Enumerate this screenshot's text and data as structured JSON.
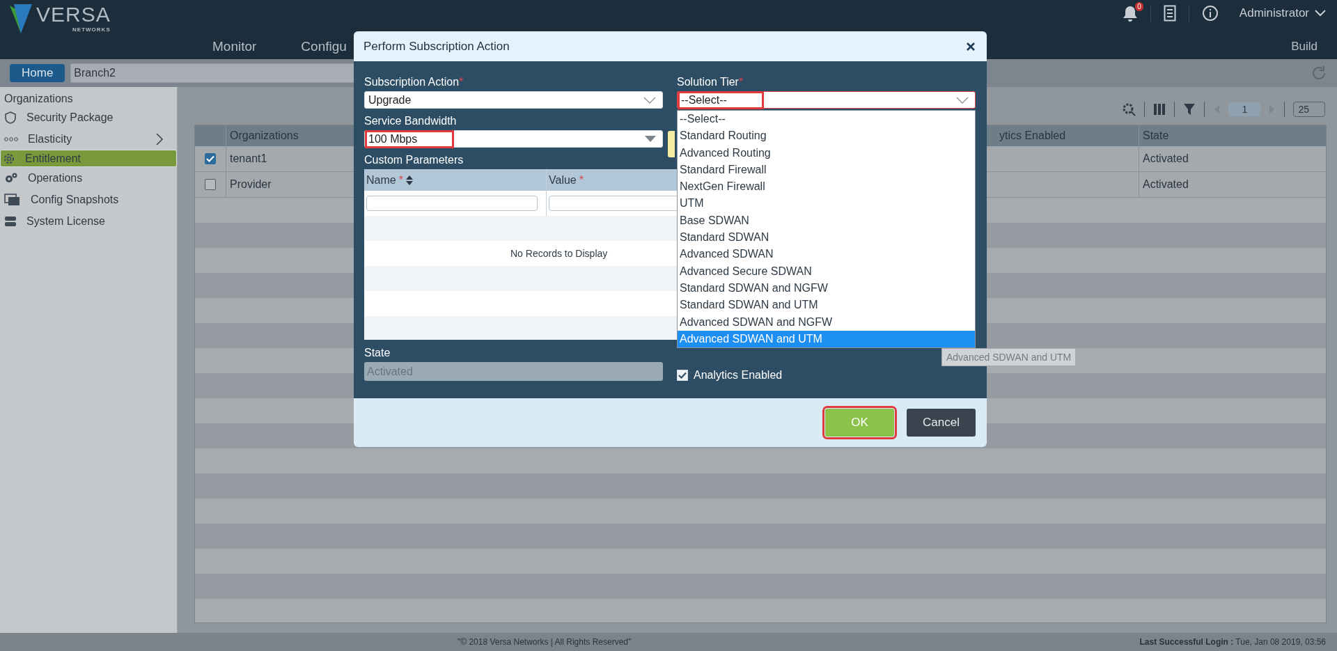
{
  "header": {
    "logo_text": "VERSA",
    "logo_sub": "NETWORKS",
    "notification_count": "0",
    "user": "Administrator"
  },
  "nav": [
    {
      "label": "Monitor",
      "selected": false
    },
    {
      "label": "Configu",
      "selected": false
    }
  ],
  "nav_right": {
    "label": "Build",
    "selected": false
  },
  "breadcrumb": {
    "home": "Home",
    "branch": "Branch2"
  },
  "sidebar": {
    "heading": "Organizations",
    "items": [
      {
        "label": "Security Package",
        "kind": "shield",
        "selected": false,
        "expandable": false
      },
      {
        "label": "Elasticity",
        "kind": "chain",
        "selected": false,
        "expandable": true
      },
      {
        "label": "Entitlement",
        "kind": "gear",
        "selected": true,
        "expandable": false
      },
      {
        "label": "Operations",
        "kind": "gears",
        "selected": false,
        "expandable": false
      },
      {
        "label": "Config Snapshots",
        "kind": "photos",
        "selected": false,
        "expandable": false
      },
      {
        "label": "System License",
        "kind": "server",
        "selected": false,
        "expandable": false
      }
    ]
  },
  "toolbar": {
    "page": "1",
    "page_size": "25"
  },
  "table": {
    "columns": [
      "Organizations",
      "ytics Enabled",
      "State"
    ],
    "rows": [
      {
        "checked": true,
        "organization": "tenant1",
        "state": "Activated"
      },
      {
        "checked": false,
        "organization": "Provider",
        "state": "Activated"
      }
    ]
  },
  "modal": {
    "title": "Perform Subscription Action",
    "subscription_action": {
      "label": "Subscription Action",
      "value": "Upgrade",
      "annotated": false
    },
    "service_bandwidth": {
      "label": "Service Bandwidth",
      "value": "100 Mbps",
      "annotated": true
    },
    "solution_tier": {
      "label": "Solution Tier",
      "value": "--Select--",
      "annotated": true,
      "expanded": true
    },
    "required_mark": "*",
    "tier_options": [
      {
        "label": "--Select--",
        "selected": false
      },
      {
        "label": "Standard Routing",
        "selected": false
      },
      {
        "label": "Advanced Routing",
        "selected": false
      },
      {
        "label": "Standard Firewall",
        "selected": false
      },
      {
        "label": "NextGen Firewall",
        "selected": false
      },
      {
        "label": "UTM",
        "selected": false
      },
      {
        "label": "Base SDWAN",
        "selected": false
      },
      {
        "label": "Standard SDWAN",
        "selected": false
      },
      {
        "label": "Advanced SDWAN",
        "selected": false
      },
      {
        "label": "Advanced Secure SDWAN",
        "selected": false
      },
      {
        "label": "Standard SDWAN and NGFW",
        "selected": false
      },
      {
        "label": "Standard SDWAN and UTM",
        "selected": false
      },
      {
        "label": "Advanced SDWAN and NGFW",
        "selected": false
      },
      {
        "label": "Advanced SDWAN and UTM",
        "selected": true
      }
    ],
    "tooltip": "Advanced SDWAN and UTM",
    "custom_parameters": {
      "label": "Custom Parameters",
      "columns": [
        "Name",
        "Value"
      ],
      "empty_text": "No Records to Display"
    },
    "state": {
      "label": "State",
      "value": "Activated",
      "disabled": true
    },
    "analytics": {
      "label": "Analytics Enabled",
      "checked": true
    },
    "buttons": [
      {
        "label": "OK",
        "kind": "primary",
        "annotated": true
      },
      {
        "label": "Cancel",
        "kind": "secondary",
        "annotated": false
      }
    ]
  },
  "footer": {
    "copyright": "\"© 2018 Versa Networks | All Rights Reserved\"",
    "login_label": "Last Successful Login :",
    "login_value": "Tue, Jan 08 2019, 03:56"
  }
}
